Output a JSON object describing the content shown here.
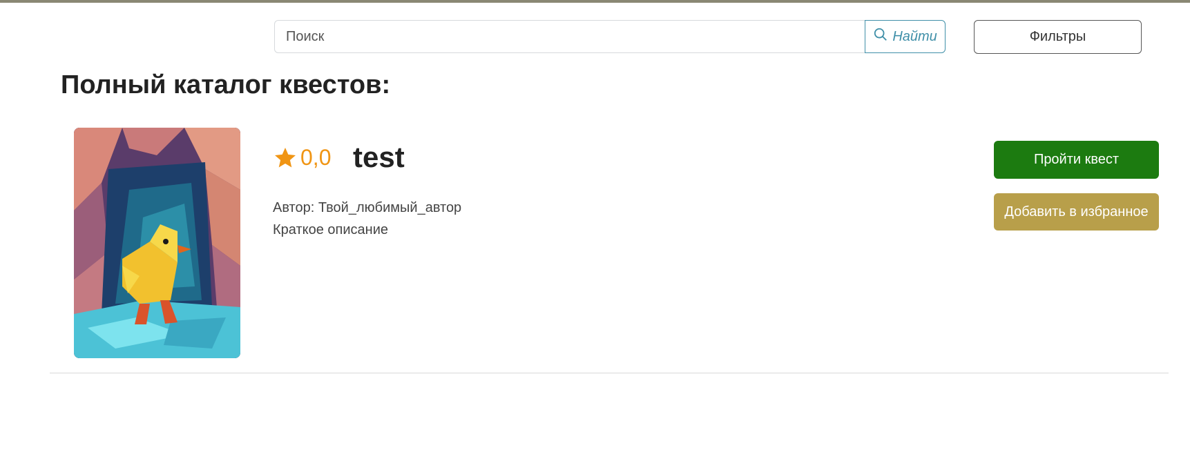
{
  "search": {
    "placeholder": "Поиск",
    "button_label": "Найти",
    "button_icon": "search-icon"
  },
  "filters": {
    "label": "Фильтры"
  },
  "page": {
    "title": "Полный каталог квестов:"
  },
  "quests": [
    {
      "title": "test",
      "rating": "0,0",
      "author": "Автор: Твой_любимый_автор",
      "description": "Краткое описание",
      "start_label": "Пройти квест",
      "favorite_label": "Добавить в избранное",
      "cover_icon": "duck-in-cave-image"
    }
  ],
  "colors": {
    "accent_blue": "#3f8fa8",
    "rating_orange": "#f09514",
    "start_green": "#1c7b10",
    "favorite_gold": "#b89f4a",
    "top_strip": "#8a8874"
  }
}
